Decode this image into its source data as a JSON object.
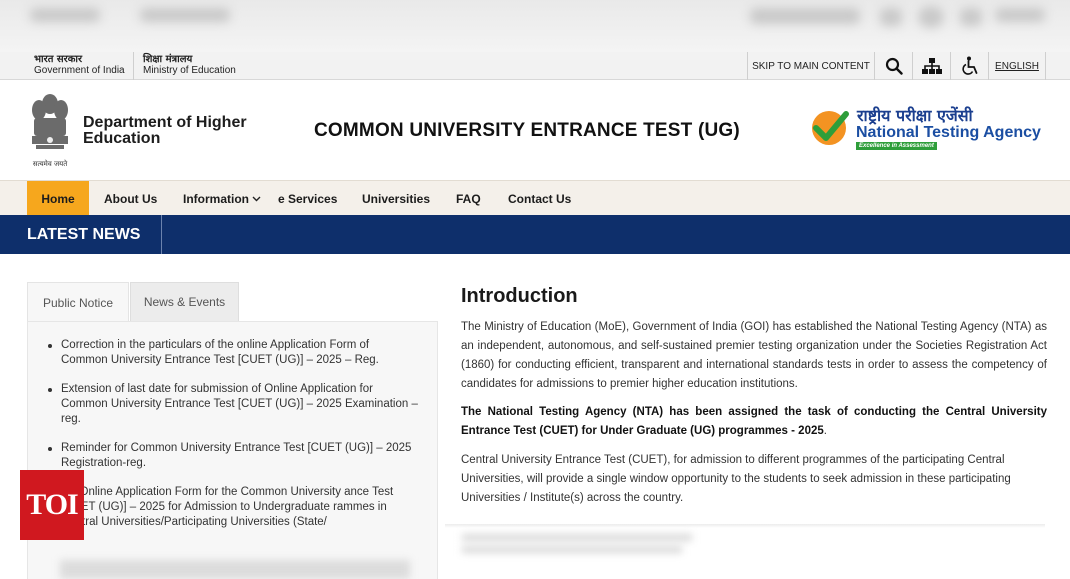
{
  "gov": {
    "hindi_gov": "भारत सरकार",
    "english_gov": "Government of India",
    "hindi_ministry": "शिक्षा मंत्रालय",
    "english_ministry": "Ministry of Education"
  },
  "utility": {
    "skip_label": "SKIP TO MAIN CONTENT",
    "language_label": "ENGLISH",
    "icons": [
      "search-icon",
      "sitemap-icon",
      "accessibility-icon"
    ]
  },
  "header": {
    "emblem_motto": "सत्यमेव जयते",
    "dept_line1": "Department of Higher",
    "dept_line2": "Education",
    "title": "COMMON UNIVERSITY ENTRANCE TEST (UG)",
    "nta_hindi": "राष्ट्रीय परीक्षा एजेंसी",
    "nta_english": "National Testing Agency",
    "nta_tagline": "Excellence in Assessment"
  },
  "nav": {
    "items": [
      {
        "label": "Home"
      },
      {
        "label": "About Us"
      },
      {
        "label": "Information"
      },
      {
        "label": "e Services"
      },
      {
        "label": "Universities"
      },
      {
        "label": "FAQ"
      },
      {
        "label": "Contact Us"
      }
    ],
    "active": "Home"
  },
  "news_bar": {
    "label": "LATEST NEWS"
  },
  "left_panel": {
    "tabs": [
      {
        "label": "Public Notice"
      },
      {
        "label": "News & Events"
      }
    ],
    "active_tab": "Public Notice",
    "notices": [
      "Correction in the particulars of the online Application Form of Common University Entrance Test [CUET (UG)] – 2025 – Reg.",
      "Extension of last date for submission of Online Application for Common University Entrance Test [CUET (UG)] – 2025 Examination – reg.",
      "Reminder for Common University Entrance Test [CUET (UG)] – 2025 Registration-reg.",
      "ing Online Application Form for the Common University ance Test [CUET (UG)] – 2025 for Admission to Undergraduate rammes in Central Universities/Participating Universities (State/"
    ]
  },
  "intro": {
    "title": "Introduction",
    "para1": "The Ministry of Education (MoE), Government of India (GOI) has established the National Testing Agency (NTA) as an independent, autonomous, and self-sustained premier testing organization under the Societies Registration Act (1860) for conducting efficient, transparent and international standards tests in order to assess the competency of candidates for admissions to premier higher education institutions.",
    "para2_bold": "The National Testing Agency (NTA) has been assigned the task of conducting the Central University Entrance Test (CUET) for Under Graduate (UG) programmes - 2025",
    "para2_end": ".",
    "para3": "Central University Entrance Test (CUET), for admission to different programmes of the participating Central Universities, will provide a single window opportunity to the students to seek admission in these participating Universities / Institute(s) across the country."
  },
  "watermark": {
    "label": "TOI",
    "color": "#d0181f"
  },
  "colors": {
    "nav_active": "#f6a71d",
    "news_bar": "#0e2f6b",
    "nta_blue": "#1b4ea2",
    "nta_green": "#2e9e3a"
  }
}
